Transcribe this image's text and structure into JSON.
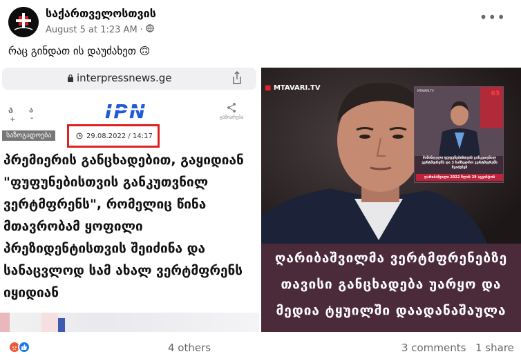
{
  "post": {
    "page_name": "საქართველოსთვის",
    "timestamp": "August 5 at 1:23 AM",
    "separator": "·",
    "privacy_icon": "globe-icon",
    "more_label": "•••",
    "text": "რაც გინდათ ის დაუძახეთ 🙃"
  },
  "left_image": {
    "url": "interpressnews.ge",
    "font_small": "ა",
    "font_large": "ა",
    "font_plus": "+",
    "font_minus": "-",
    "logo": "IPN",
    "share_label": "გაზიარება",
    "category": "საზოგადოება",
    "date": "29.08.2022 / 14:17",
    "headline": "პრემიერის განცხადებით, გაყიდიან \"ფუფუნებისთვის განკუთვნილ ვერტმფრენს\", რომელიც წინა მთავრობამ ყოფილი პრეზიდენტისთვის შეიძინა და სანაცვლოდ სამ ახალ ვერტმფრენს იყიდიან"
  },
  "right_image": {
    "tv_logo": "MTAVARI.TV",
    "inset_label": "MTAVARI.TV",
    "inset_number": "63",
    "inset_text": "მაშინდელი ფუფუნებისთვის განკუთვნილ ვერტმფრენს და 3 სამხედრო ვერტმფრენს შეიძენენ",
    "inset_date": "ღარიბაშვილი 2022 წლის 29 აგვისტოს",
    "caption_lines": [
      "ღარიბაშვილმა ვერტმფრენებზე",
      "თავისი განცხადება უარყო და",
      "მედია ტყუილში დაადანაშაულა"
    ]
  },
  "footer": {
    "reactions": [
      "angry",
      "like"
    ],
    "others": "4 others",
    "comments": "3 comments",
    "shares": "1 share"
  },
  "colors": {
    "accent_red": "#e02020",
    "ipn_blue": "#1f5bd8",
    "caption_bg": "#4b2a3a",
    "like_blue": "#1877f2"
  }
}
